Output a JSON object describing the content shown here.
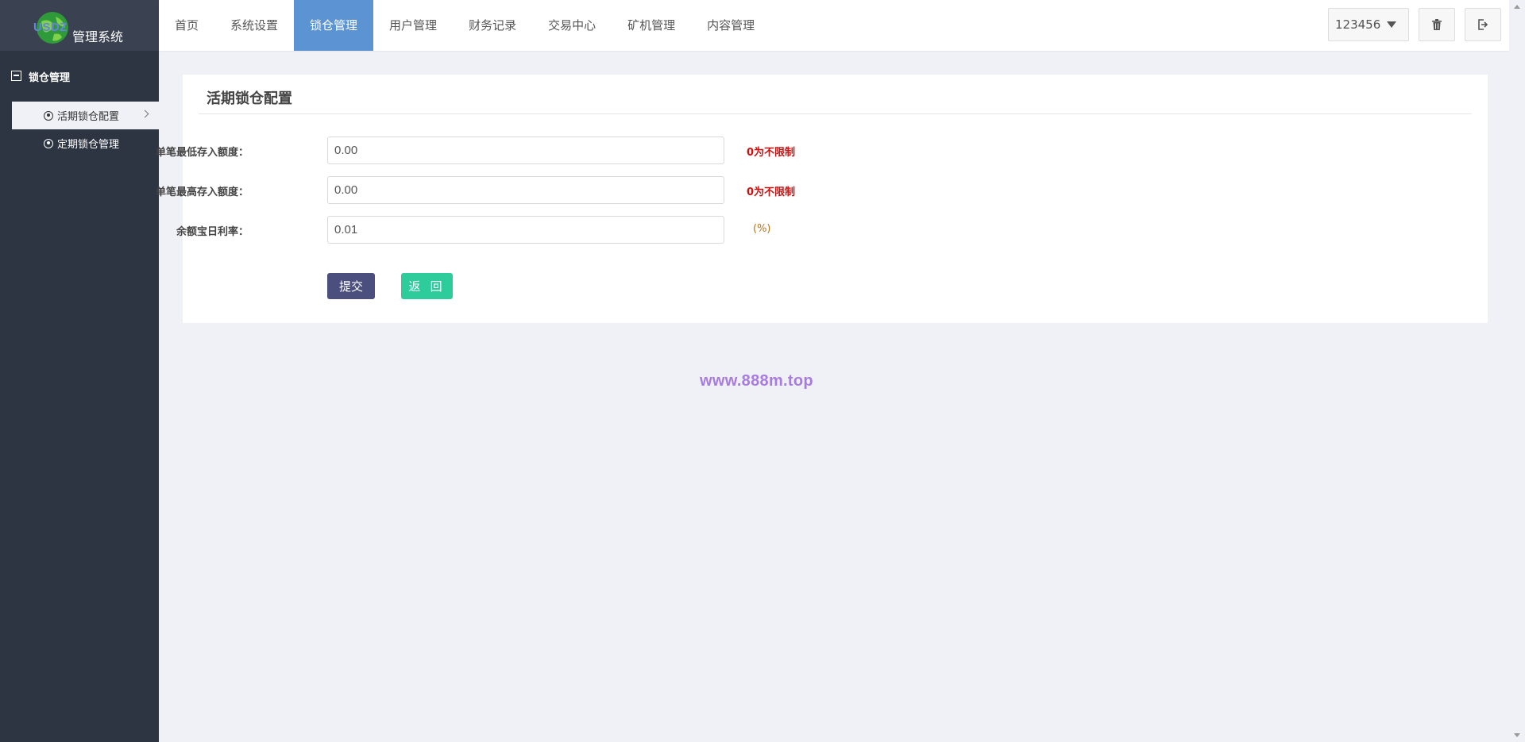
{
  "brand": {
    "logo_text": "USDZ",
    "title": "管理系统"
  },
  "nav": {
    "items": [
      {
        "label": "首页"
      },
      {
        "label": "系统设置"
      },
      {
        "label": "锁仓管理"
      },
      {
        "label": "用户管理"
      },
      {
        "label": "财务记录"
      },
      {
        "label": "交易中心"
      },
      {
        "label": "矿机管理"
      },
      {
        "label": "内容管理"
      }
    ],
    "active_index": 2
  },
  "topbar": {
    "user_label": "123456",
    "delete_icon": "trash-icon",
    "logout_icon": "logout-icon"
  },
  "sidebar": {
    "group_label": "锁仓管理",
    "items": [
      {
        "label": "活期锁仓配置",
        "active": true
      },
      {
        "label": "定期锁仓管理",
        "active": false
      }
    ]
  },
  "panel": {
    "title": "活期锁仓配置",
    "fields": [
      {
        "label": "单笔最低存入额度：",
        "value": "0.00",
        "hint": "0为不限制"
      },
      {
        "label": "单笔最高存入额度：",
        "value": "0.00",
        "hint": "0为不限制"
      },
      {
        "label": "余额宝日利率：",
        "value": "0.01",
        "hint": "(%)"
      }
    ],
    "submit_label": "提交",
    "back_label": "返 回"
  },
  "watermark": "www.888m.top",
  "colors": {
    "sidebar_bg": "#2d3442",
    "nav_active": "#5b93d3",
    "hint_red": "#cc1111",
    "submit_bg": "#4a4f7e",
    "back_bg": "#2ecc9b",
    "watermark": "#a77be0"
  }
}
